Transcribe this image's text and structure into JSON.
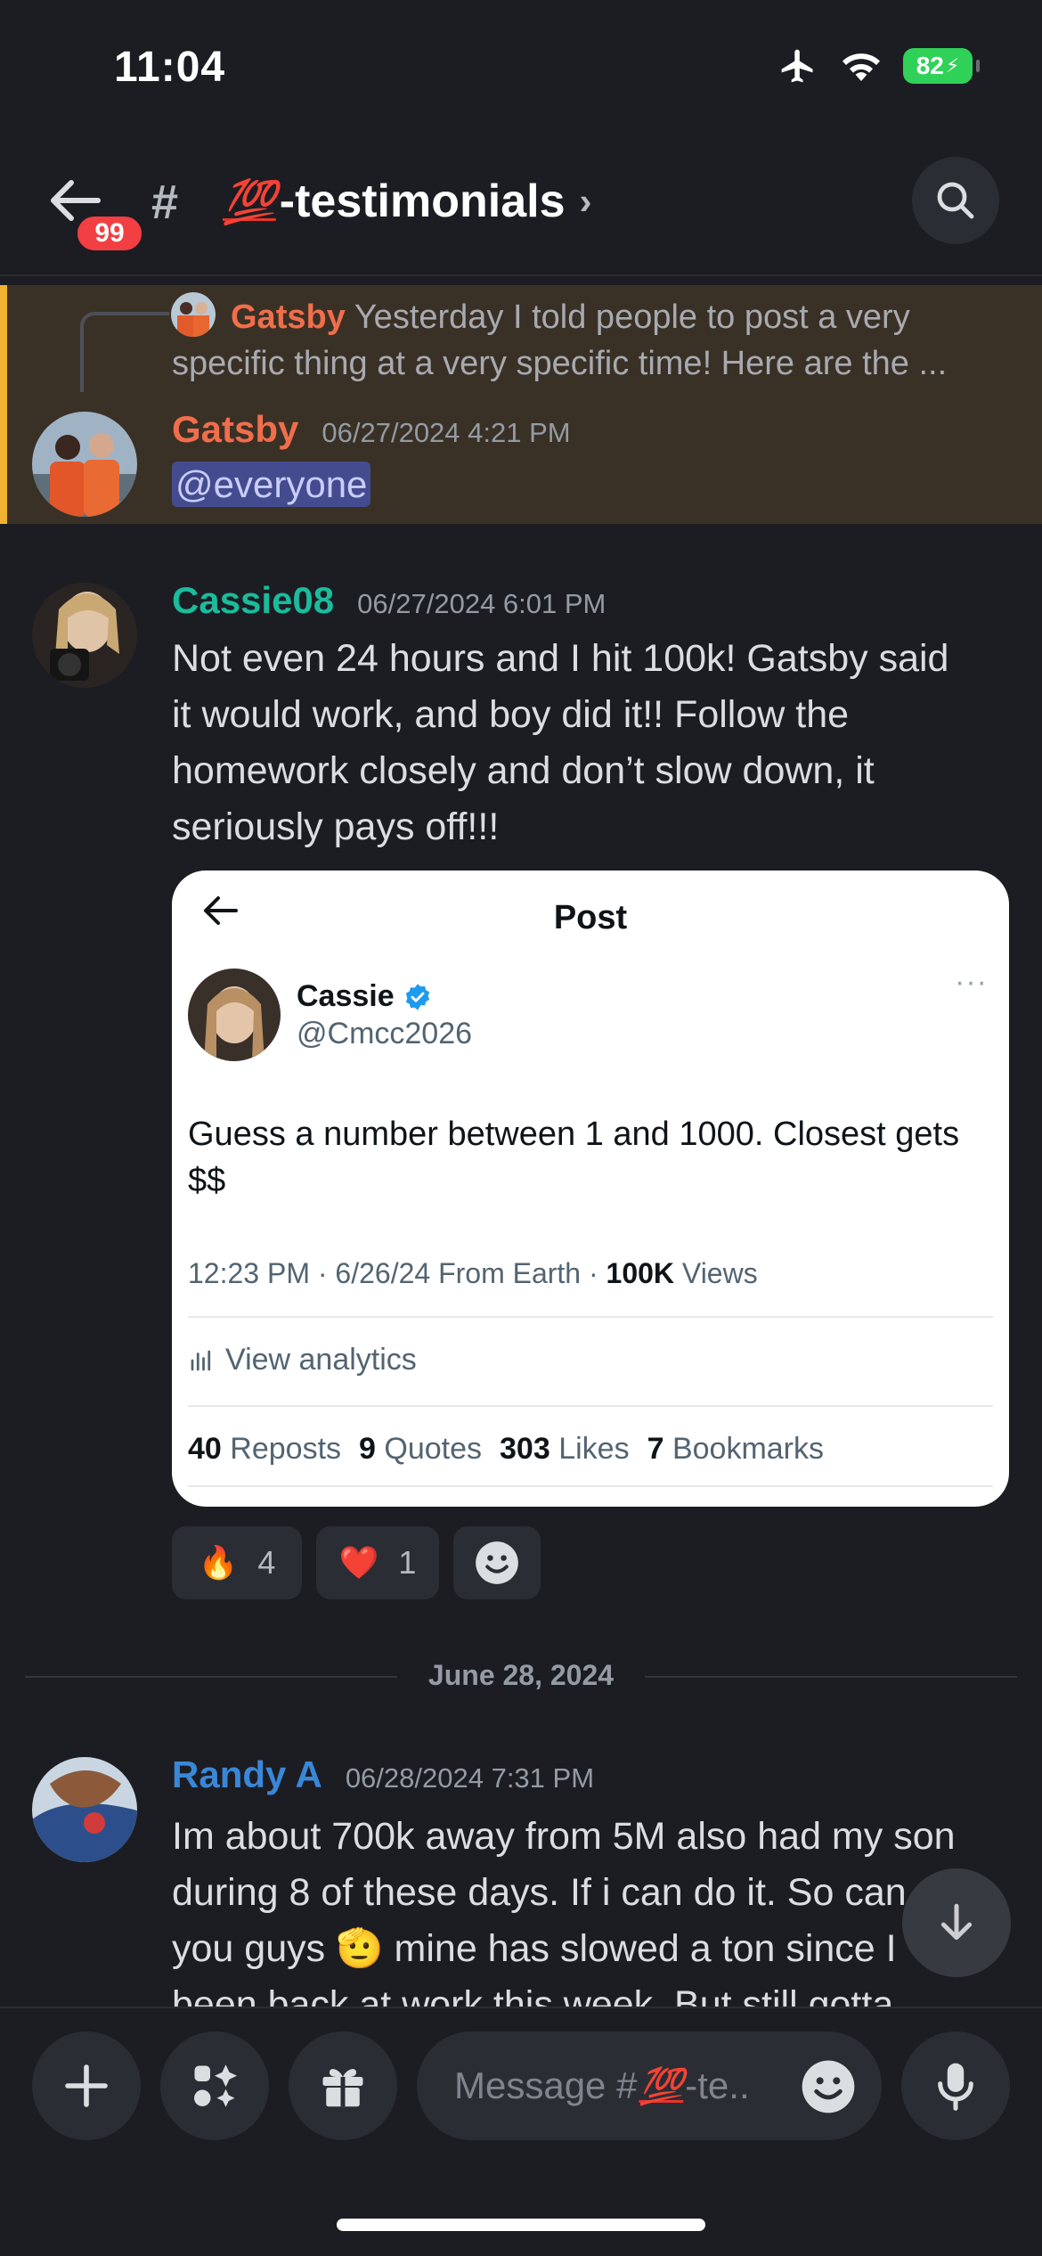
{
  "status_bar": {
    "time": "11:04",
    "battery": "82"
  },
  "header": {
    "unread_badge": "99",
    "hash": "#",
    "channel_emoji": "💯",
    "channel_name": "-testimonials",
    "chevron": "›"
  },
  "messages": [
    {
      "highlighted": true,
      "reply": {
        "author": "Gatsby",
        "text": "Yesterday I told people to post a very specific thing at a very specific time! Here are the ..."
      },
      "author": "Gatsby",
      "author_color": "#f06e4c",
      "timestamp": "06/27/2024 4:21 PM",
      "mention": "@everyone"
    },
    {
      "author": "Cassie08",
      "author_color": "#1abc9c",
      "timestamp": "06/27/2024 6:01 PM",
      "lines": [
        "Not even 24 hours and I hit 100k! Gatsby said",
        "it would work, and boy did it!! Follow the",
        "homework closely and don’t slow down, it",
        "seriously pays off!!!"
      ],
      "embed": {
        "title": "Post",
        "name": "Cassie",
        "handle": "@Cmcc2026",
        "more": "···",
        "body": "Guess a number between 1 and 1000. Closest gets $$",
        "meta_prefix": "12:23 PM · 6/26/24 From Earth · ",
        "meta_views_value": "100K",
        "meta_views_label": "Views",
        "analytics": "View analytics",
        "stats": [
          {
            "value": "40",
            "label": "Reposts"
          },
          {
            "value": "9",
            "label": "Quotes"
          },
          {
            "value": "303",
            "label": "Likes"
          },
          {
            "value": "7",
            "label": "Bookmarks"
          }
        ]
      },
      "reactions": [
        {
          "emoji": "🔥",
          "count": "4"
        },
        {
          "emoji": "❤️",
          "count": "1"
        }
      ]
    },
    {
      "author": "Randy A",
      "author_color": "#3a87d8",
      "timestamp": "06/28/2024 7:31 PM",
      "lines": [
        "Im about 700k away from 5M also had my son",
        "during 8 of these days. If i can do it. So can",
        "you guys 🫡 mine has slowed a ton since I",
        "been back at work this week. But still gotta"
      ]
    }
  ],
  "date_separator": "June 28, 2024",
  "composer": {
    "placeholder_prefix": "Message #",
    "placeholder_emoji": "💯",
    "placeholder_suffix": "-te.."
  },
  "colors": {
    "background": "#1c1d23",
    "highlight": "#3a3126",
    "highlight_bar": "#f0b232",
    "badge": "#f23f43"
  }
}
